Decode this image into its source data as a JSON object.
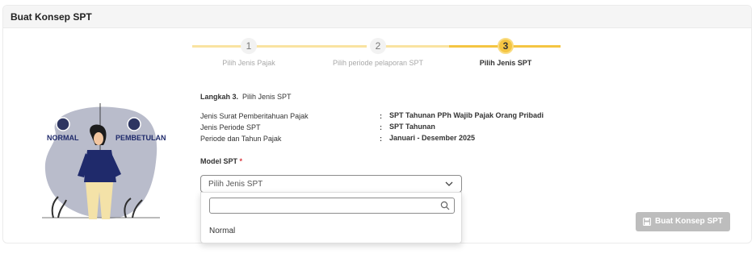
{
  "header": {
    "title": "Buat Konsep SPT"
  },
  "stepper": {
    "steps": [
      {
        "number": "1",
        "label": "Pilih Jenis Pajak",
        "state": "done"
      },
      {
        "number": "2",
        "label": "Pilih periode pelaporan SPT",
        "state": "done"
      },
      {
        "number": "3",
        "label": "Pilih Jenis SPT",
        "state": "active"
      }
    ],
    "line_color": "#f9e3a1",
    "active_color": "#f4c542"
  },
  "illustration": {
    "left_label": "NORMAL",
    "right_label": "PEMBETULAN"
  },
  "form": {
    "step_title": "Langkah 3.",
    "step_subtitle": "Pilih Jenis SPT",
    "info": [
      {
        "label": "Jenis Surat Pemberitahuan Pajak",
        "sep": ":",
        "value": "SPT Tahunan PPh Wajib Pajak Orang Pribadi"
      },
      {
        "label": "Jenis Periode SPT",
        "sep": ":",
        "value": "SPT Tahunan"
      },
      {
        "label": "Periode dan Tahun Pajak",
        "sep": ":",
        "value": "Januari - Desember 2025"
      }
    ],
    "model_label": "Model SPT",
    "required_mark": "*",
    "select_placeholder": "Pilih Jenis SPT",
    "search_value": "",
    "options": [
      "Normal"
    ]
  },
  "actions": {
    "create_label": "Buat Konsep SPT",
    "create_icon": "save-icon"
  }
}
